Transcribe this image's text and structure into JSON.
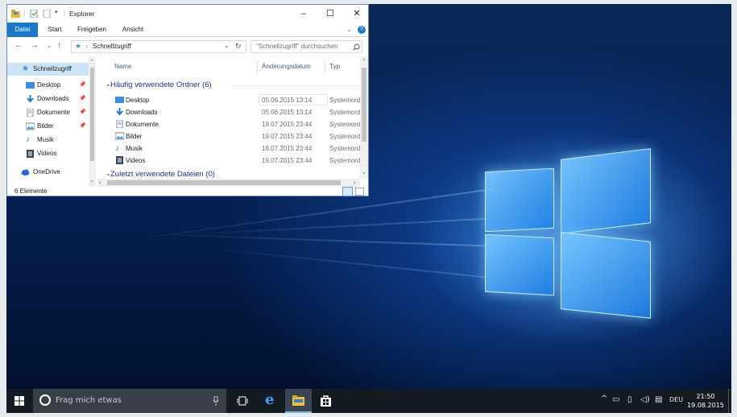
{
  "window": {
    "title": "Explorer",
    "controls": {
      "minimize": "–",
      "maximize": "☐",
      "close": "✕"
    }
  },
  "ribbon": {
    "tabs": [
      {
        "label": "Datei",
        "active": true
      },
      {
        "label": "Start",
        "active": false
      },
      {
        "label": "Freigeben",
        "active": false
      },
      {
        "label": "Ansicht",
        "active": false
      }
    ],
    "help_icon": "?"
  },
  "address": {
    "path": "Schnellzugriff",
    "search_placeholder": "\"Schnellzugriff\" durchsuchen"
  },
  "nav": {
    "items": [
      {
        "label": "Schnellzugriff",
        "icon": "star-icon",
        "selected": true,
        "pinned": false
      },
      {
        "label": "Desktop",
        "icon": "desktop-folder-icon",
        "pinned": true
      },
      {
        "label": "Downloads",
        "icon": "download-arrow-icon",
        "pinned": true
      },
      {
        "label": "Dokumente",
        "icon": "document-icon",
        "pinned": true
      },
      {
        "label": "Bilder",
        "icon": "pictures-icon",
        "pinned": true
      },
      {
        "label": "Musik",
        "icon": "music-note-icon",
        "pinned": false
      },
      {
        "label": "Videos",
        "icon": "film-icon",
        "pinned": false
      },
      {
        "label": "OneDrive",
        "icon": "cloud-icon",
        "pinned": false
      }
    ]
  },
  "content": {
    "columns": [
      "Name",
      "Änderungsdatum",
      "Typ"
    ],
    "group_frequent": "Häufig verwendete Ordner (6)",
    "group_recent": "Zuletzt verwendete Dateien (0)",
    "rows": [
      {
        "name": "Desktop",
        "date": "05.06.2015 13:14",
        "type": "Systemordn",
        "icon": "desktop-folder-icon"
      },
      {
        "name": "Downloads",
        "date": "05.06.2015 13:14",
        "type": "Systemordn",
        "icon": "download-arrow-icon"
      },
      {
        "name": "Dokumente",
        "date": "19.07.2015 23:44",
        "type": "Systemordn",
        "icon": "document-icon"
      },
      {
        "name": "Bilder",
        "date": "19.07.2015 23:44",
        "type": "Systemordn",
        "icon": "pictures-icon"
      },
      {
        "name": "Musik",
        "date": "19.07.2015 23:44",
        "type": "Systemordn",
        "icon": "music-note-icon"
      },
      {
        "name": "Videos",
        "date": "19.07.2015 23:44",
        "type": "Systemordn",
        "icon": "film-icon"
      }
    ]
  },
  "status": {
    "count": "6 Elemente"
  },
  "taskbar": {
    "search_placeholder": "Frag mich etwas",
    "language": "DEU",
    "time": "21:50",
    "date": "19.08.2015"
  },
  "colors": {
    "accent": "#1979ca",
    "group_header": "#1e3287",
    "taskbar": "#141a22"
  }
}
